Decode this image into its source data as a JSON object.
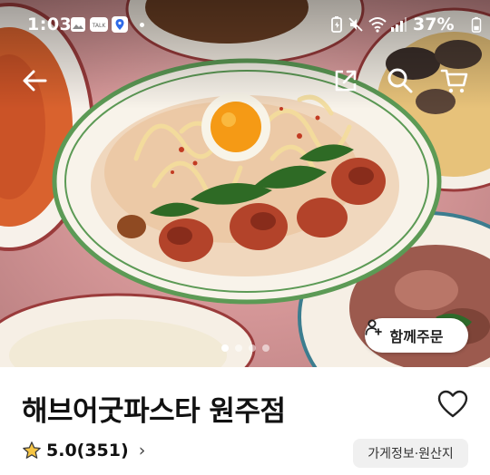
{
  "status_bar": {
    "time": "1:03",
    "battery_percent": "37%",
    "left_icons": [
      "gallery-icon",
      "talk-icon",
      "map-pin-app-icon"
    ],
    "right_icons": [
      "battery-saver-icon",
      "mute-icon",
      "wifi-icon",
      "signal-icon",
      "battery-icon"
    ]
  },
  "app_bar": {
    "back_icon": "arrow-left-icon",
    "actions": [
      "share-icon",
      "search-icon",
      "cart-icon"
    ]
  },
  "hero": {
    "image_count": 4,
    "active_index": 0,
    "group_order_label": "함께주문"
  },
  "store": {
    "name": "해브어굿파스타 원주점",
    "rating_text": "5.0(351)",
    "rating_value": 5.0,
    "review_count": 351,
    "info_chip": "가게정보·원산지"
  },
  "colors": {
    "accent_star": "#F6C544",
    "plate_rim_green": "#5C9A55",
    "plate_rim_red": "#8A2A2A"
  }
}
